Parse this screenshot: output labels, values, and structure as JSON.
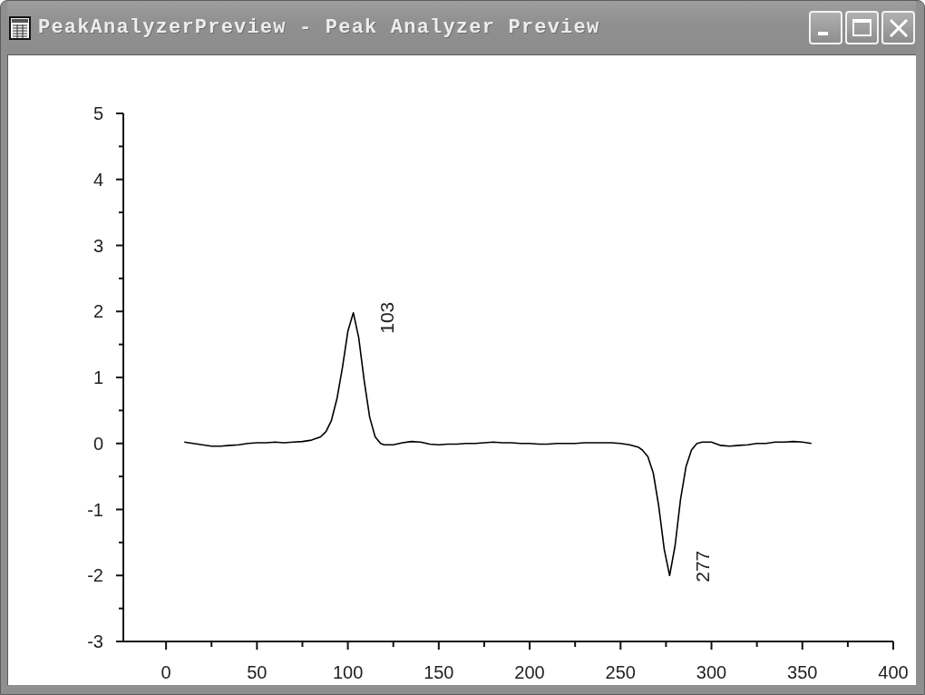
{
  "window": {
    "title": "PeakAnalyzerPreview - Peak Analyzer Preview"
  },
  "plot": {
    "chart_data": {
      "type": "line",
      "x": [
        10,
        15,
        20,
        25,
        30,
        35,
        40,
        45,
        50,
        55,
        60,
        65,
        70,
        75,
        80,
        85,
        88,
        91,
        94,
        97,
        100,
        103,
        106,
        109,
        112,
        115,
        118,
        120,
        125,
        130,
        135,
        140,
        145,
        150,
        155,
        160,
        165,
        170,
        175,
        180,
        185,
        190,
        195,
        200,
        205,
        210,
        215,
        220,
        225,
        230,
        235,
        240,
        245,
        250,
        255,
        260,
        262,
        265,
        268,
        271,
        274,
        277,
        280,
        283,
        286,
        289,
        292,
        295,
        300,
        305,
        310,
        315,
        320,
        325,
        330,
        335,
        340,
        345,
        350,
        355
      ],
      "series": [
        {
          "color": "#000000",
          "values": [
            0.02,
            0.0,
            -0.02,
            -0.04,
            -0.04,
            -0.03,
            -0.02,
            0.0,
            0.01,
            0.01,
            0.02,
            0.01,
            0.02,
            0.03,
            0.05,
            0.1,
            0.18,
            0.35,
            0.68,
            1.15,
            1.7,
            1.98,
            1.6,
            0.95,
            0.4,
            0.1,
            0.0,
            -0.02,
            -0.02,
            0.01,
            0.03,
            0.02,
            -0.01,
            -0.02,
            -0.01,
            -0.01,
            0.0,
            0.0,
            0.01,
            0.02,
            0.01,
            0.01,
            0.0,
            0.0,
            -0.01,
            -0.01,
            0.0,
            0.0,
            0.0,
            0.01,
            0.01,
            0.01,
            0.01,
            0.0,
            -0.02,
            -0.06,
            -0.1,
            -0.2,
            -0.45,
            -0.95,
            -1.6,
            -2.0,
            -1.55,
            -0.85,
            -0.35,
            -0.1,
            0.0,
            0.02,
            0.02,
            -0.03,
            -0.04,
            -0.03,
            -0.02,
            0.0,
            0.0,
            0.02,
            0.02,
            0.03,
            0.02,
            0.0
          ]
        }
      ],
      "xlim": [
        -23.5,
        400
      ],
      "ylim": [
        -3,
        5
      ],
      "xticks": [
        0,
        50,
        100,
        150,
        200,
        250,
        300,
        350,
        400
      ],
      "yticks": [
        -3,
        -2,
        -1,
        0,
        1,
        2,
        3,
        4,
        5
      ],
      "annotations": [
        {
          "x": 103,
          "y": 2,
          "text": "103"
        },
        {
          "x": 277,
          "y": -2,
          "text": "277"
        }
      ]
    }
  }
}
